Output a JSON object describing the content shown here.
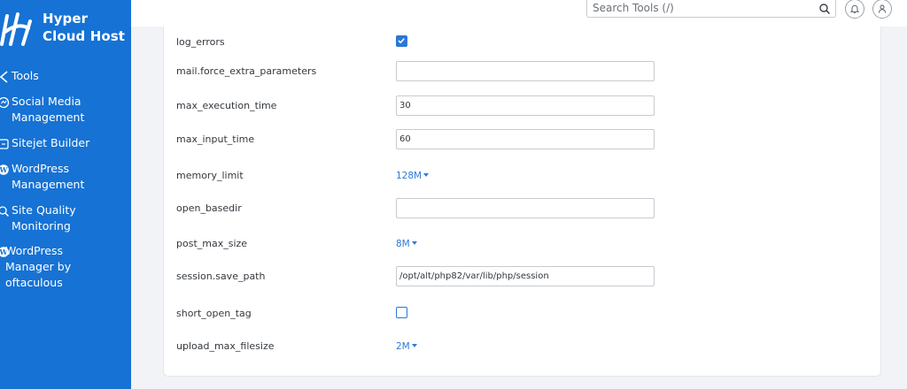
{
  "brand": {
    "name_line1": "Hyper",
    "name_line2": "Cloud Host"
  },
  "sidebar": {
    "items": [
      {
        "label": "Tools",
        "icon": "tools-icon"
      },
      {
        "label": "Social Media\nManagement",
        "icon": "social-media-icon"
      },
      {
        "label": "Sitejet Builder",
        "icon": "sitejet-icon"
      },
      {
        "label": "WordPress\nManagement",
        "icon": "wordpress-icon"
      },
      {
        "label": "Site Quality\nMonitoring",
        "icon": "site-quality-icon"
      },
      {
        "label": " WordPress\n Manager by\noftaculous",
        "icon": "wordpress-icon"
      }
    ]
  },
  "topbar": {
    "search_placeholder": "Search Tools (/)",
    "search_icon": "search-icon",
    "notifications_icon": "bell-icon",
    "user_icon": "user-icon"
  },
  "settings": {
    "rows": [
      {
        "name": "log_errors",
        "type": "checkbox",
        "checked": true
      },
      {
        "name": "mail.force_extra_parameters",
        "type": "text",
        "value": ""
      },
      {
        "name": "max_execution_time",
        "type": "text",
        "value": "30"
      },
      {
        "name": "max_input_time",
        "type": "text",
        "value": "60"
      },
      {
        "name": "memory_limit",
        "type": "select",
        "value": "128M"
      },
      {
        "name": "open_basedir",
        "type": "text",
        "value": ""
      },
      {
        "name": "post_max_size",
        "type": "select",
        "value": "8M"
      },
      {
        "name": "session.save_path",
        "type": "text",
        "value": "/opt/alt/php82/var/lib/php/session"
      },
      {
        "name": "short_open_tag",
        "type": "checkbox",
        "checked": false
      },
      {
        "name": "upload_max_filesize",
        "type": "select",
        "value": "2M"
      }
    ]
  },
  "colors": {
    "sidebar_bg": "#1672d4",
    "accent": "#2f7bd9"
  }
}
